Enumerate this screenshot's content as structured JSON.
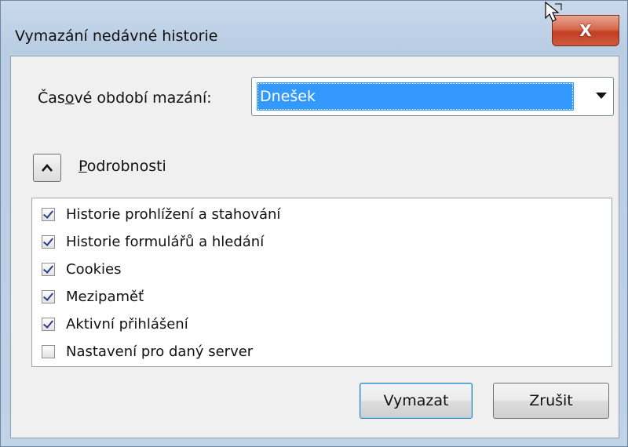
{
  "window": {
    "title": "Vymazání nedávné historie",
    "close_label": "X"
  },
  "time_range": {
    "label_before": "Čas",
    "label_accel": "o",
    "label_after": "vé období mazání:",
    "selected": "Dnešek"
  },
  "details": {
    "accel": "P",
    "label_rest": "odrobnosti"
  },
  "items": [
    {
      "label": "Historie prohlížení a stahování",
      "checked": true
    },
    {
      "label": "Historie formulářů a hledání",
      "checked": true
    },
    {
      "label": "Cookies",
      "checked": true
    },
    {
      "label": "Mezipaměť",
      "checked": true
    },
    {
      "label": "Aktivní přihlášení",
      "checked": true
    },
    {
      "label": "Nastavení pro daný server",
      "checked": false
    }
  ],
  "buttons": {
    "clear": "Vymazat",
    "cancel": "Zrušit"
  },
  "colors": {
    "selection": "#3399ff",
    "close_button": "#c8442a"
  }
}
